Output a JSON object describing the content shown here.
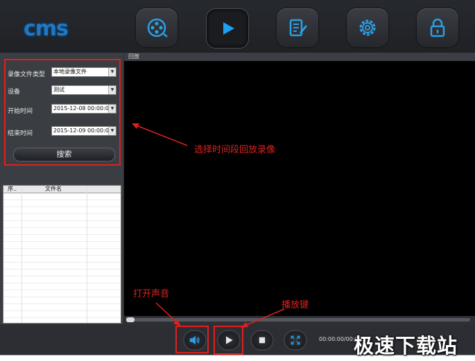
{
  "app": {
    "logo_text": "cms"
  },
  "nav": [
    {
      "name": "nav-preview-button",
      "icon": "film-reel-icon"
    },
    {
      "name": "nav-playback-button",
      "icon": "play-icon",
      "active": true
    },
    {
      "name": "nav-log-button",
      "icon": "document-edit-icon"
    },
    {
      "name": "nav-settings-button",
      "icon": "gear-icon"
    },
    {
      "name": "nav-lock-button",
      "icon": "lock-icon"
    }
  ],
  "filter": {
    "file_type_label": "录像文件类型",
    "file_type_value": "本地录像文件",
    "device_label": "设备",
    "device_value": "测试",
    "start_label": "开始时间",
    "start_value": "2015-12-08 00:00:00",
    "end_label": "结束时间",
    "end_value": "2015-12-09 00:00:00",
    "search_label": "搜索"
  },
  "table": {
    "columns": [
      "序..",
      "文件名"
    ]
  },
  "player": {
    "header": "回放",
    "time_readout": "00:00:00/00:00:00"
  },
  "annotations": {
    "filter_note": "选择时间段回放录像",
    "sound_note": "打开声音",
    "play_note": "播放键"
  },
  "watermark": "极速下载站",
  "colors": {
    "accent": "#1e78c4",
    "annotation": "#e02020",
    "background": "#2b2d31"
  }
}
